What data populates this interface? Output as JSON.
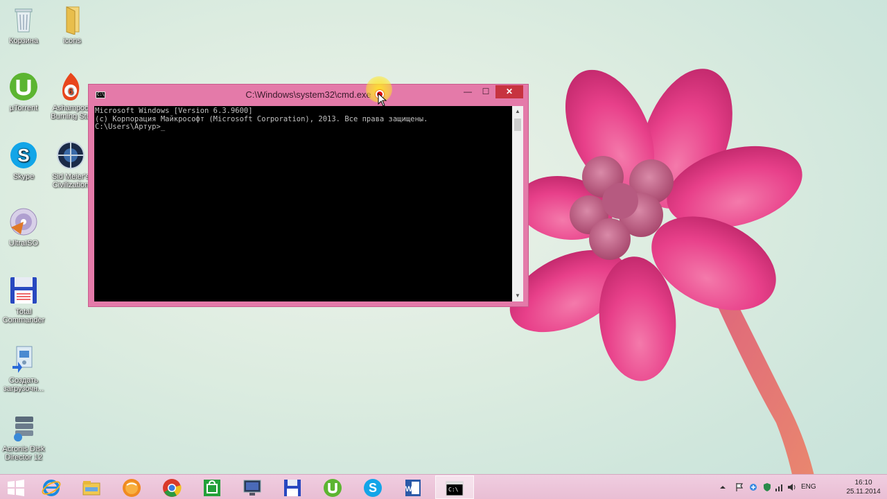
{
  "desktop": {
    "icons": [
      {
        "label": "Корзина",
        "icon": "recycle-bin-icon"
      },
      {
        "label": "icons",
        "icon": "folder-icon"
      },
      {
        "label": "µTorrent",
        "icon": "utorrent-icon"
      },
      {
        "label": "Ashampoo\nBurning Stu",
        "icon": "ashampoo-burning-icon"
      },
      {
        "label": "Skype",
        "icon": "skype-icon"
      },
      {
        "label": "Sid Meier's\nCivilization",
        "icon": "civilization-icon"
      },
      {
        "label": "UltraISO",
        "icon": "ultraiso-icon"
      },
      {
        "label": "Total\nCommander",
        "icon": "total-commander-icon"
      },
      {
        "label": "Создать\nзагрузочн...",
        "icon": "create-bootable-icon"
      },
      {
        "label": "Acronis Disk\nDirector 12",
        "icon": "acronis-icon"
      }
    ]
  },
  "cmd": {
    "title": "C:\\Windows\\system32\\cmd.exe",
    "sys_icon": "C:\\",
    "minimize": "—",
    "maximize": "☐",
    "close": "✕",
    "lines": [
      "Microsoft Windows [Version 6.3.9600]",
      "(c) Корпорация Майкрософт (Microsoft Corporation), 2013. Все права защищены.",
      "",
      "C:\\Users\\Артур>_"
    ]
  },
  "taskbar": {
    "buttons": [
      "start",
      "internet-explorer",
      "file-explorer",
      "media-player",
      "chrome",
      "store",
      "ampps",
      "total-commander",
      "utorrent",
      "skype",
      "word",
      "cmd"
    ],
    "language": "ENG",
    "time": "16:10",
    "date": "25.11.2014"
  },
  "colors": {
    "window_frame": "#e47aa9",
    "close_button": "#c7333f",
    "taskbar": "#eec5da",
    "flower": "#e8488a"
  }
}
